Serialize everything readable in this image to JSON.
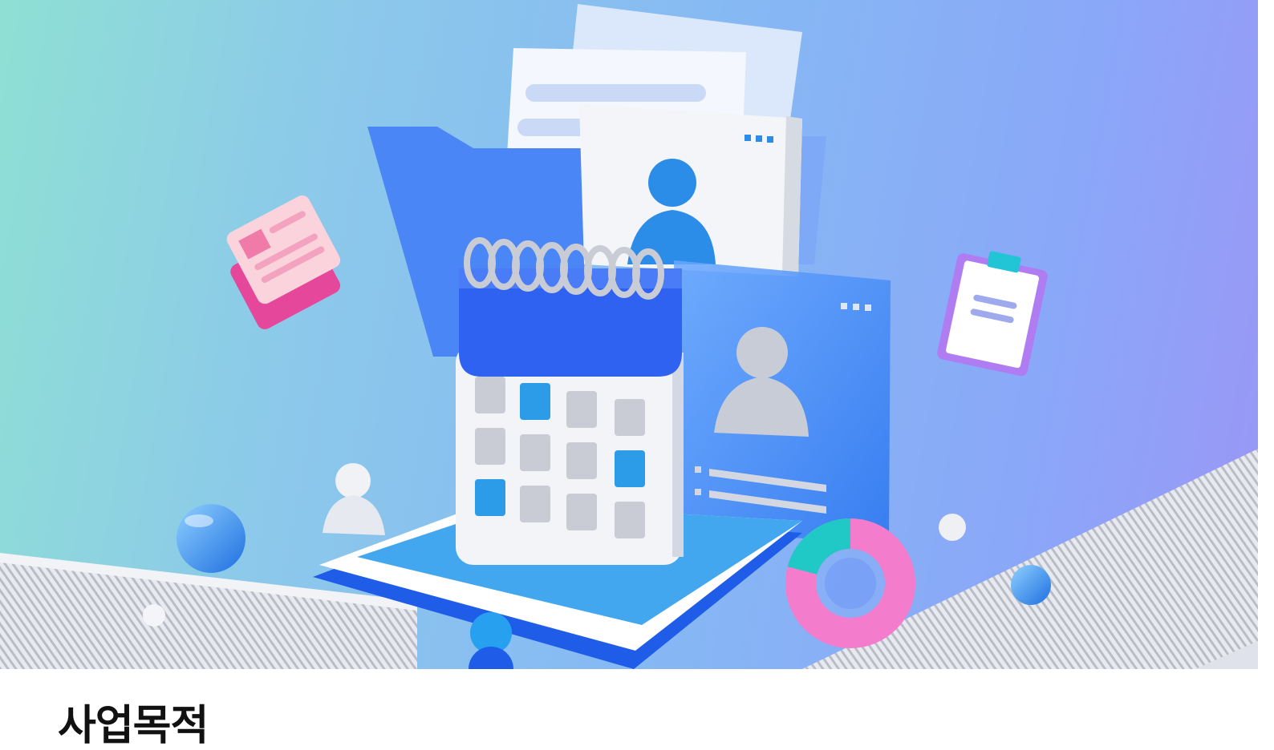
{
  "section": {
    "title": "사업목적"
  },
  "hero": {
    "illustration": "business-documents-calendar-3d-illustration",
    "colors": {
      "background_start": "#8fe0d4",
      "background_end": "#9a96f6",
      "calendar_blue": "#2f62f0",
      "folder_blue": "#4a86f5",
      "accent_pink": "#f05aa8",
      "accent_teal": "#26c7c9",
      "accent_purple": "#b07cf2"
    }
  }
}
